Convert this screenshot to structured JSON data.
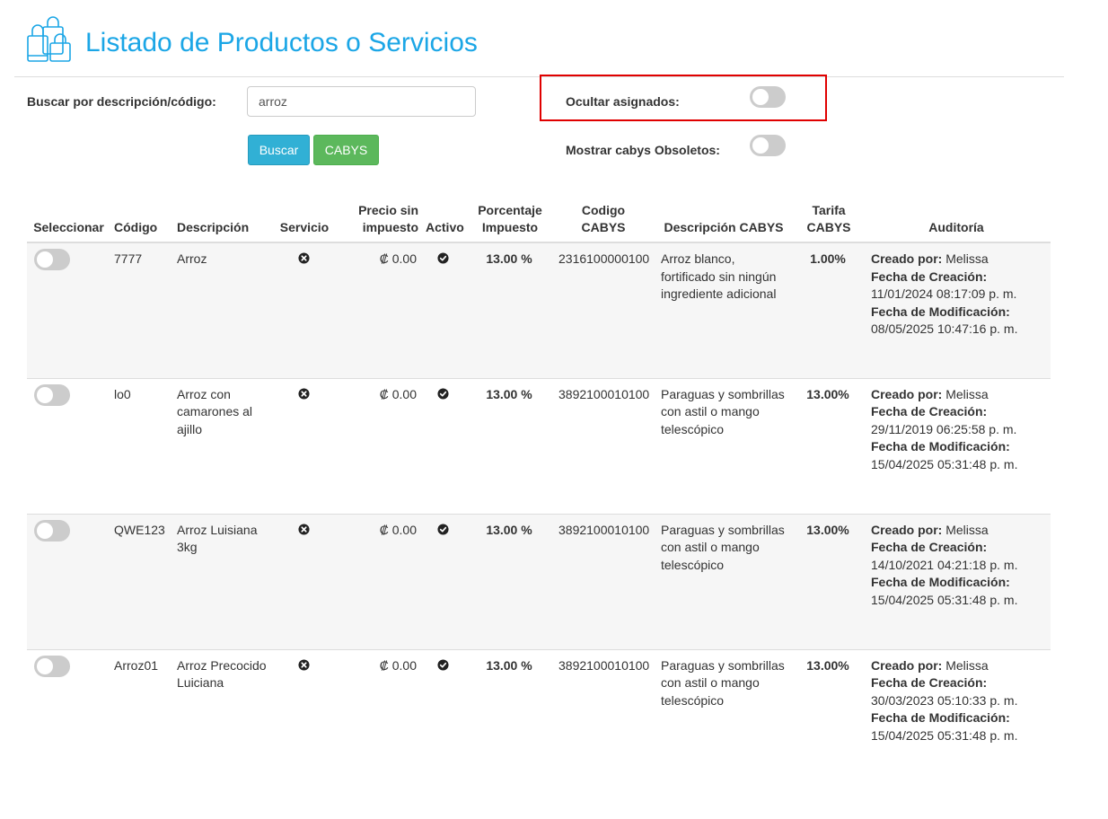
{
  "header": {
    "title": "Listado de Productos o Servicios",
    "icon": "shopping-bags-icon",
    "accent_color": "#1ba6e6"
  },
  "search": {
    "label": "Buscar por descripción/código:",
    "value": "arroz",
    "buscar_label": "Buscar",
    "cabys_label": "CABYS"
  },
  "filters": {
    "ocultar_label": "Ocultar asignados:",
    "ocultar_on": false,
    "obsoletos_label": "Mostrar cabys Obsoletos:",
    "obsoletos_on": false
  },
  "table": {
    "headers": {
      "seleccionar": "Seleccionar",
      "codigo": "Código",
      "descripcion": "Descripción",
      "servicio": "Servicio",
      "precio": "Precio sin impuesto",
      "activo": "Activo",
      "porcentaje": "Porcentaje Impuesto",
      "codigo_cabys": "Codigo CABYS",
      "descripcion_cabys": "Descripción CABYS",
      "tarifa": "Tarifa CABYS",
      "auditoria": "Auditoría"
    },
    "audit_labels": {
      "creado": "Creado por:",
      "fecha_creacion": "Fecha de Creación:",
      "fecha_modificacion": "Fecha de Modificación:"
    },
    "rows": [
      {
        "codigo": "7777",
        "descripcion": "Arroz",
        "servicio": false,
        "precio": "₡ 0.00",
        "activo": true,
        "porcentaje": "13.00 %",
        "codigo_cabys": "2316100000100",
        "descripcion_cabys": "Arroz blanco, fortificado sin ningún ingrediente adicional",
        "tarifa": "1.00%",
        "creado_por": "Melissa",
        "fecha_creacion": "11/01/2024 08:17:09 p. m.",
        "fecha_modificacion": "08/05/2025 10:47:16 p. m."
      },
      {
        "codigo": "lo0",
        "descripcion": "Arroz con camarones al ajillo",
        "servicio": false,
        "precio": "₡ 0.00",
        "activo": true,
        "porcentaje": "13.00 %",
        "codigo_cabys": "3892100010100",
        "descripcion_cabys": "Paraguas y sombrillas con astil o mango telescópico",
        "tarifa": "13.00%",
        "creado_por": "Melissa",
        "fecha_creacion": "29/11/2019 06:25:58 p. m.",
        "fecha_modificacion": "15/04/2025 05:31:48 p. m."
      },
      {
        "codigo": "QWE123",
        "descripcion": "Arroz Luisiana 3kg",
        "servicio": false,
        "precio": "₡ 0.00",
        "activo": true,
        "porcentaje": "13.00 %",
        "codigo_cabys": "3892100010100",
        "descripcion_cabys": "Paraguas y sombrillas con astil o mango telescópico",
        "tarifa": "13.00%",
        "creado_por": "Melissa",
        "fecha_creacion": "14/10/2021 04:21:18 p. m.",
        "fecha_modificacion": "15/04/2025 05:31:48 p. m."
      },
      {
        "codigo": "Arroz01",
        "descripcion": "Arroz Precocido Luiciana",
        "servicio": false,
        "precio": "₡ 0.00",
        "activo": true,
        "porcentaje": "13.00 %",
        "codigo_cabys": "3892100010100",
        "descripcion_cabys": "Paraguas y sombrillas con astil o mango telescópico",
        "tarifa": "13.00%",
        "creado_por": "Melissa",
        "fecha_creacion": "30/03/2023 05:10:33 p. m.",
        "fecha_modificacion": "15/04/2025 05:31:48 p. m."
      }
    ]
  }
}
